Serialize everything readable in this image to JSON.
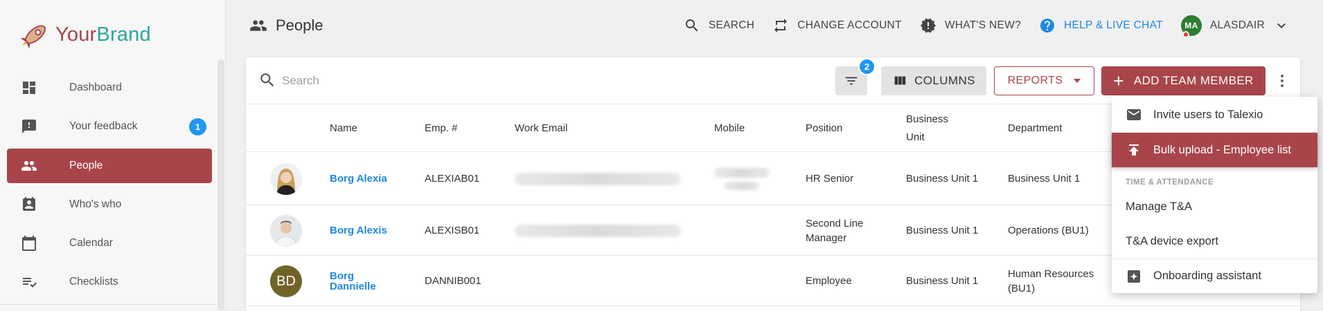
{
  "brand": {
    "name_part1": "Your",
    "name_part2": "Brand"
  },
  "sidebar": {
    "items": [
      {
        "label": "Dashboard",
        "icon": "dashboard-icon"
      },
      {
        "label": "Your feedback",
        "icon": "feedback-icon",
        "badge": "1"
      },
      {
        "label": "People",
        "icon": "people-icon",
        "active": true
      },
      {
        "label": "Who's who",
        "icon": "contact-card-icon"
      },
      {
        "label": "Calendar",
        "icon": "calendar-icon"
      },
      {
        "label": "Checklists",
        "icon": "checklist-icon"
      }
    ]
  },
  "header": {
    "title": "People",
    "search_label": "SEARCH",
    "change_account_label": "CHANGE ACCOUNT",
    "whats_new_label": "WHAT'S NEW?",
    "help_label": "HELP & LIVE CHAT",
    "user_initials": "MA",
    "user_name": "ALASDAIR"
  },
  "toolbar": {
    "search_placeholder": "Search",
    "filter_count": "2",
    "columns_label": "COLUMNS",
    "reports_label": "REPORTS",
    "add_label": "ADD TEAM MEMBER"
  },
  "table": {
    "headers": [
      "Name",
      "Emp. #",
      "Work Email",
      "Mobile",
      "Position",
      "Business Unit",
      "Department"
    ],
    "rows": [
      {
        "name": "Borg Alexia",
        "emp": "ALEXIAB01",
        "position": "HR Senior",
        "business_unit": "Business Unit 1",
        "department": "Business Unit 1"
      },
      {
        "name": "Borg Alexis",
        "emp": "ALEXISB01",
        "position": "Second Line Manager",
        "business_unit": "Business Unit 1",
        "department": "Operations (BU1)"
      },
      {
        "name": "Borg Dannielle",
        "emp": "DANNIB001",
        "initials": "BD",
        "position": "Employee",
        "business_unit": "Business Unit 1",
        "department": "Human Resources (BU1)"
      }
    ]
  },
  "menu": {
    "invite": "Invite users to Talexio",
    "bulk_upload": "Bulk upload - Employee list",
    "section_ta": "TIME & ATTENDANCE",
    "manage_ta": "Manage T&A",
    "device_export": "T&A device export",
    "onboarding": "Onboarding assistant"
  },
  "colors": {
    "accent": "#a8454a",
    "link": "#1e88e5",
    "badge": "#2196f3",
    "brand_teal": "#2aa59a"
  }
}
